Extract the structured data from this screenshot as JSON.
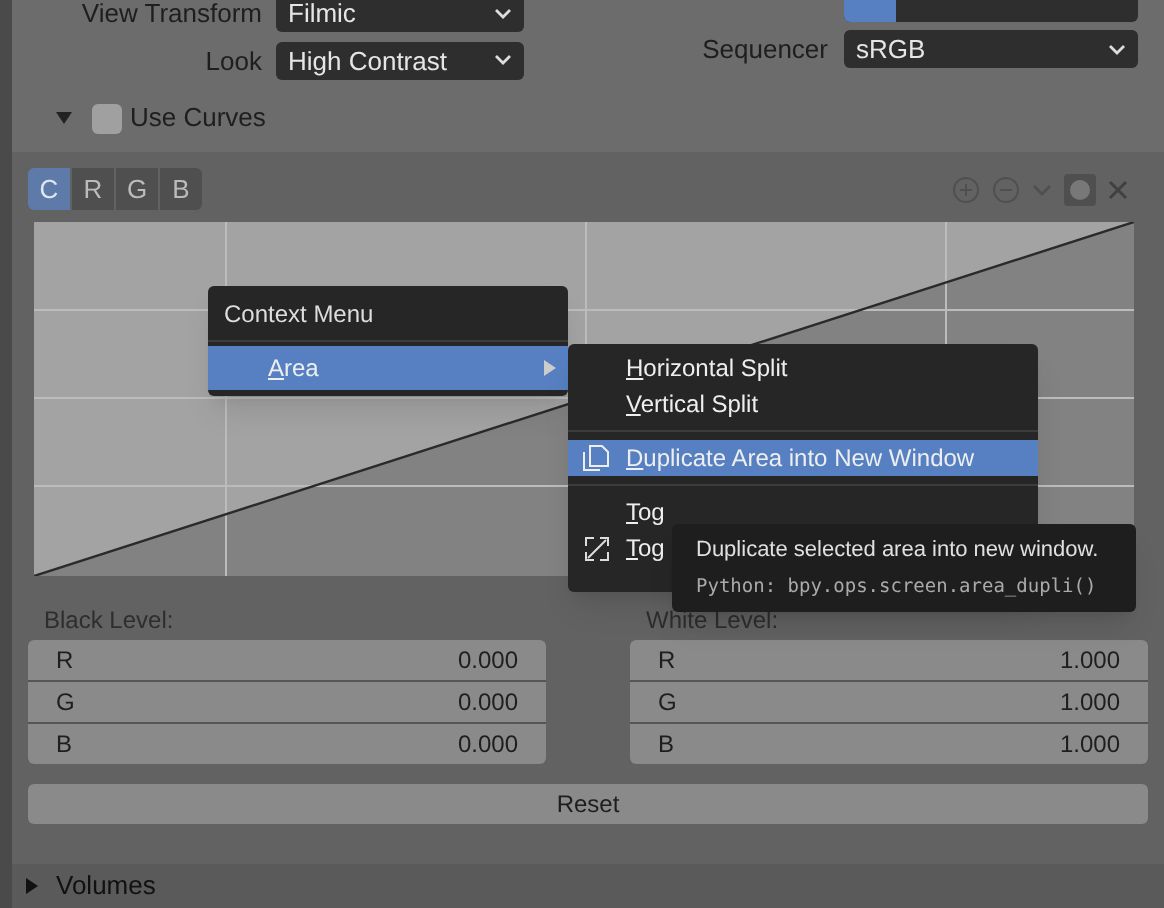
{
  "color_management": {
    "rows": [
      {
        "label": "View Transform",
        "value": "Filmic"
      },
      {
        "label": "Look",
        "value": "High Contrast"
      }
    ],
    "gamma": {
      "level": 0.18
    },
    "sequencer": {
      "label": "Sequencer",
      "value": "sRGB"
    }
  },
  "use_curves": {
    "label": "Use Curves",
    "checked": false,
    "expanded": true
  },
  "channel_tabs": [
    {
      "label": "C",
      "selected": true
    },
    {
      "label": "R",
      "selected": false
    },
    {
      "label": "G",
      "selected": false
    },
    {
      "label": "B",
      "selected": false
    }
  ],
  "black_level": {
    "label": "Black Level:",
    "fields": [
      {
        "label": "R",
        "value": "0.000"
      },
      {
        "label": "G",
        "value": "0.000"
      },
      {
        "label": "B",
        "value": "0.000"
      }
    ]
  },
  "white_level": {
    "label": "White Level:",
    "fields": [
      {
        "label": "R",
        "value": "1.000"
      },
      {
        "label": "G",
        "value": "1.000"
      },
      {
        "label": "B",
        "value": "1.000"
      }
    ]
  },
  "reset_button": "Reset",
  "volumes": {
    "label": "Volumes",
    "expanded": false
  },
  "context_menu": {
    "title": "Context Menu",
    "items": [
      {
        "label": "Area",
        "selected": true
      }
    ]
  },
  "submenu": {
    "items": [
      {
        "label": "Horizontal Split",
        "selected": false,
        "kind": "plain"
      },
      {
        "label": "Vertical Split",
        "selected": false,
        "kind": "plain"
      },
      {
        "label": "Duplicate Area into New Window",
        "selected": true,
        "kind": "duplicate"
      },
      {
        "label": "Tog",
        "selected": false,
        "kind": "plain"
      },
      {
        "label": "Tog",
        "selected": false,
        "kind": "fullscreen"
      }
    ]
  },
  "tooltip": {
    "text": "Duplicate selected area into new window.",
    "python": "Python: bpy.ops.screen.area_dupli()"
  }
}
